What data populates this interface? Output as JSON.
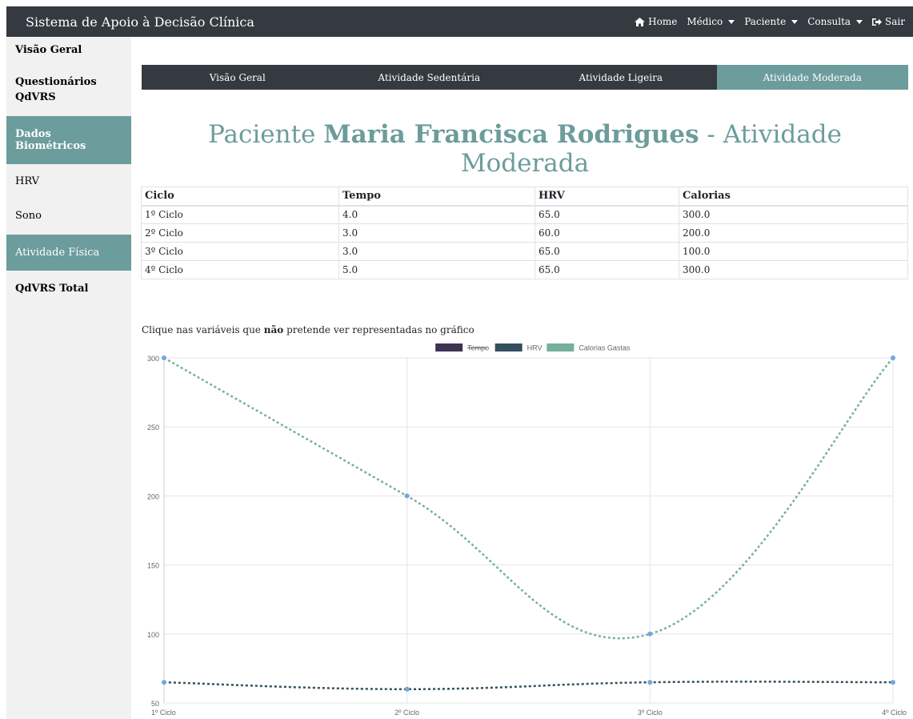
{
  "navbar": {
    "brand": "Sistema de Apoio à Decisão Clínica",
    "links": [
      {
        "label": "Home",
        "icon": "home-icon"
      },
      {
        "label": "Médico",
        "dropdown": true
      },
      {
        "label": "Paciente",
        "dropdown": true
      },
      {
        "label": "Consulta",
        "dropdown": true
      },
      {
        "label": "Sair",
        "icon": "sign-out-icon"
      }
    ]
  },
  "sidebar": {
    "items": [
      {
        "label": "Visão Geral"
      },
      {
        "label": "Questionários QdVRS"
      },
      {
        "label": "Dados Biométricos"
      },
      {
        "label": "HRV"
      },
      {
        "label": "Sono"
      },
      {
        "label": "Atividade Física"
      },
      {
        "label": "QdVRS Total"
      }
    ]
  },
  "tabs": [
    {
      "label": "Visão Geral"
    },
    {
      "label": "Atividade Sedentária"
    },
    {
      "label": "Atividade Ligeira"
    },
    {
      "label": "Atividade Moderada",
      "active": true
    }
  ],
  "title": {
    "prefix": "Paciente",
    "name": "Maria Francisca Rodrigues",
    "suffix": "- Atividade Moderada"
  },
  "table": {
    "headers": [
      "Ciclo",
      "Tempo",
      "HRV",
      "Calorias"
    ],
    "rows": [
      [
        "1º Ciclo",
        "4.0",
        "65.0",
        "300.0"
      ],
      [
        "2º Ciclo",
        "3.0",
        "60.0",
        "200.0"
      ],
      [
        "3º Ciclo",
        "3.0",
        "65.0",
        "100.0"
      ],
      [
        "4º Ciclo",
        "5.0",
        "65.0",
        "300.0"
      ]
    ]
  },
  "hint": {
    "before": "Clique nas variáveis que",
    "bold": "não",
    "after": "pretende ver representadas no gráfico"
  },
  "colors": {
    "brand_dark": "#343a40",
    "accent": "#6c9c9c",
    "tempo": "#3d3454",
    "hrv": "#34505e",
    "calorias": "#76b09b",
    "point": "#6fa8dc"
  },
  "chart_data": {
    "type": "line",
    "categories": [
      "1º Ciclo",
      "2º Ciclo",
      "3º Ciclo",
      "4º Ciclo"
    ],
    "series": [
      {
        "name": "Tempo",
        "values": [
          4.0,
          3.0,
          3.0,
          5.0
        ],
        "hidden": true
      },
      {
        "name": "HRV",
        "values": [
          65.0,
          60.0,
          65.0,
          65.0
        ]
      },
      {
        "name": "Calorias Gastas",
        "values": [
          300.0,
          200.0,
          100.0,
          300.0
        ]
      }
    ],
    "yticks": [
      50,
      100,
      150,
      200,
      250,
      300
    ],
    "ylim": [
      50,
      300
    ],
    "grid": true,
    "legend": "top-center",
    "line_style": "dashed"
  }
}
